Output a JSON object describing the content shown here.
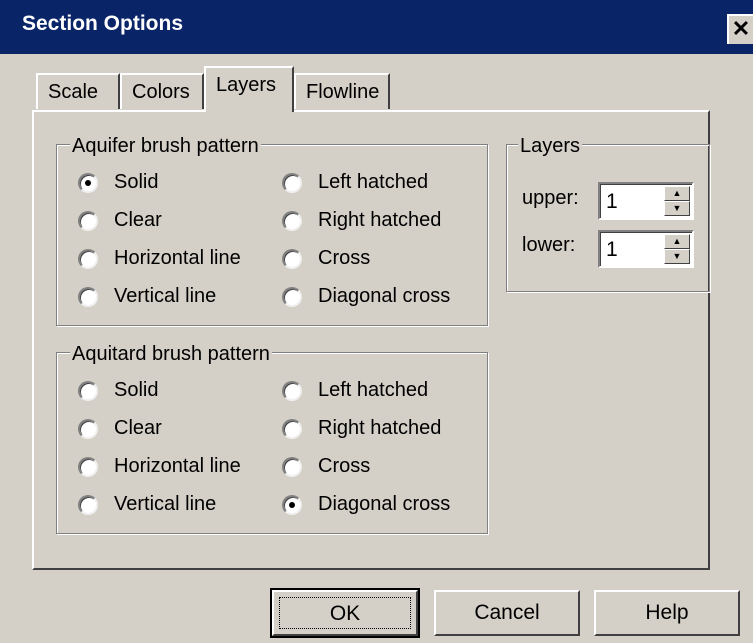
{
  "window": {
    "title": "Section Options",
    "close_glyph": "✕"
  },
  "tabs": [
    {
      "label": "Scale",
      "active": false
    },
    {
      "label": "Colors",
      "active": false
    },
    {
      "label": "Layers",
      "active": true
    },
    {
      "label": "Flowline",
      "active": false
    }
  ],
  "aquifer": {
    "label": "Aquifer brush pattern",
    "options": [
      "Solid",
      "Clear",
      "Horizontal line",
      "Vertical line",
      "Left hatched",
      "Right hatched",
      "Cross",
      "Diagonal cross"
    ],
    "selected": "Solid"
  },
  "aquitard": {
    "label": "Aquitard brush pattern",
    "options": [
      "Solid",
      "Clear",
      "Horizontal line",
      "Vertical line",
      "Left hatched",
      "Right hatched",
      "Cross",
      "Diagonal cross"
    ],
    "selected": "Diagonal cross"
  },
  "layers": {
    "label": "Layers",
    "upper_label": "upper:",
    "upper_value": "1",
    "lower_label": "lower:",
    "lower_value": "1"
  },
  "buttons": {
    "ok": "OK",
    "cancel": "Cancel",
    "help": "Help"
  }
}
